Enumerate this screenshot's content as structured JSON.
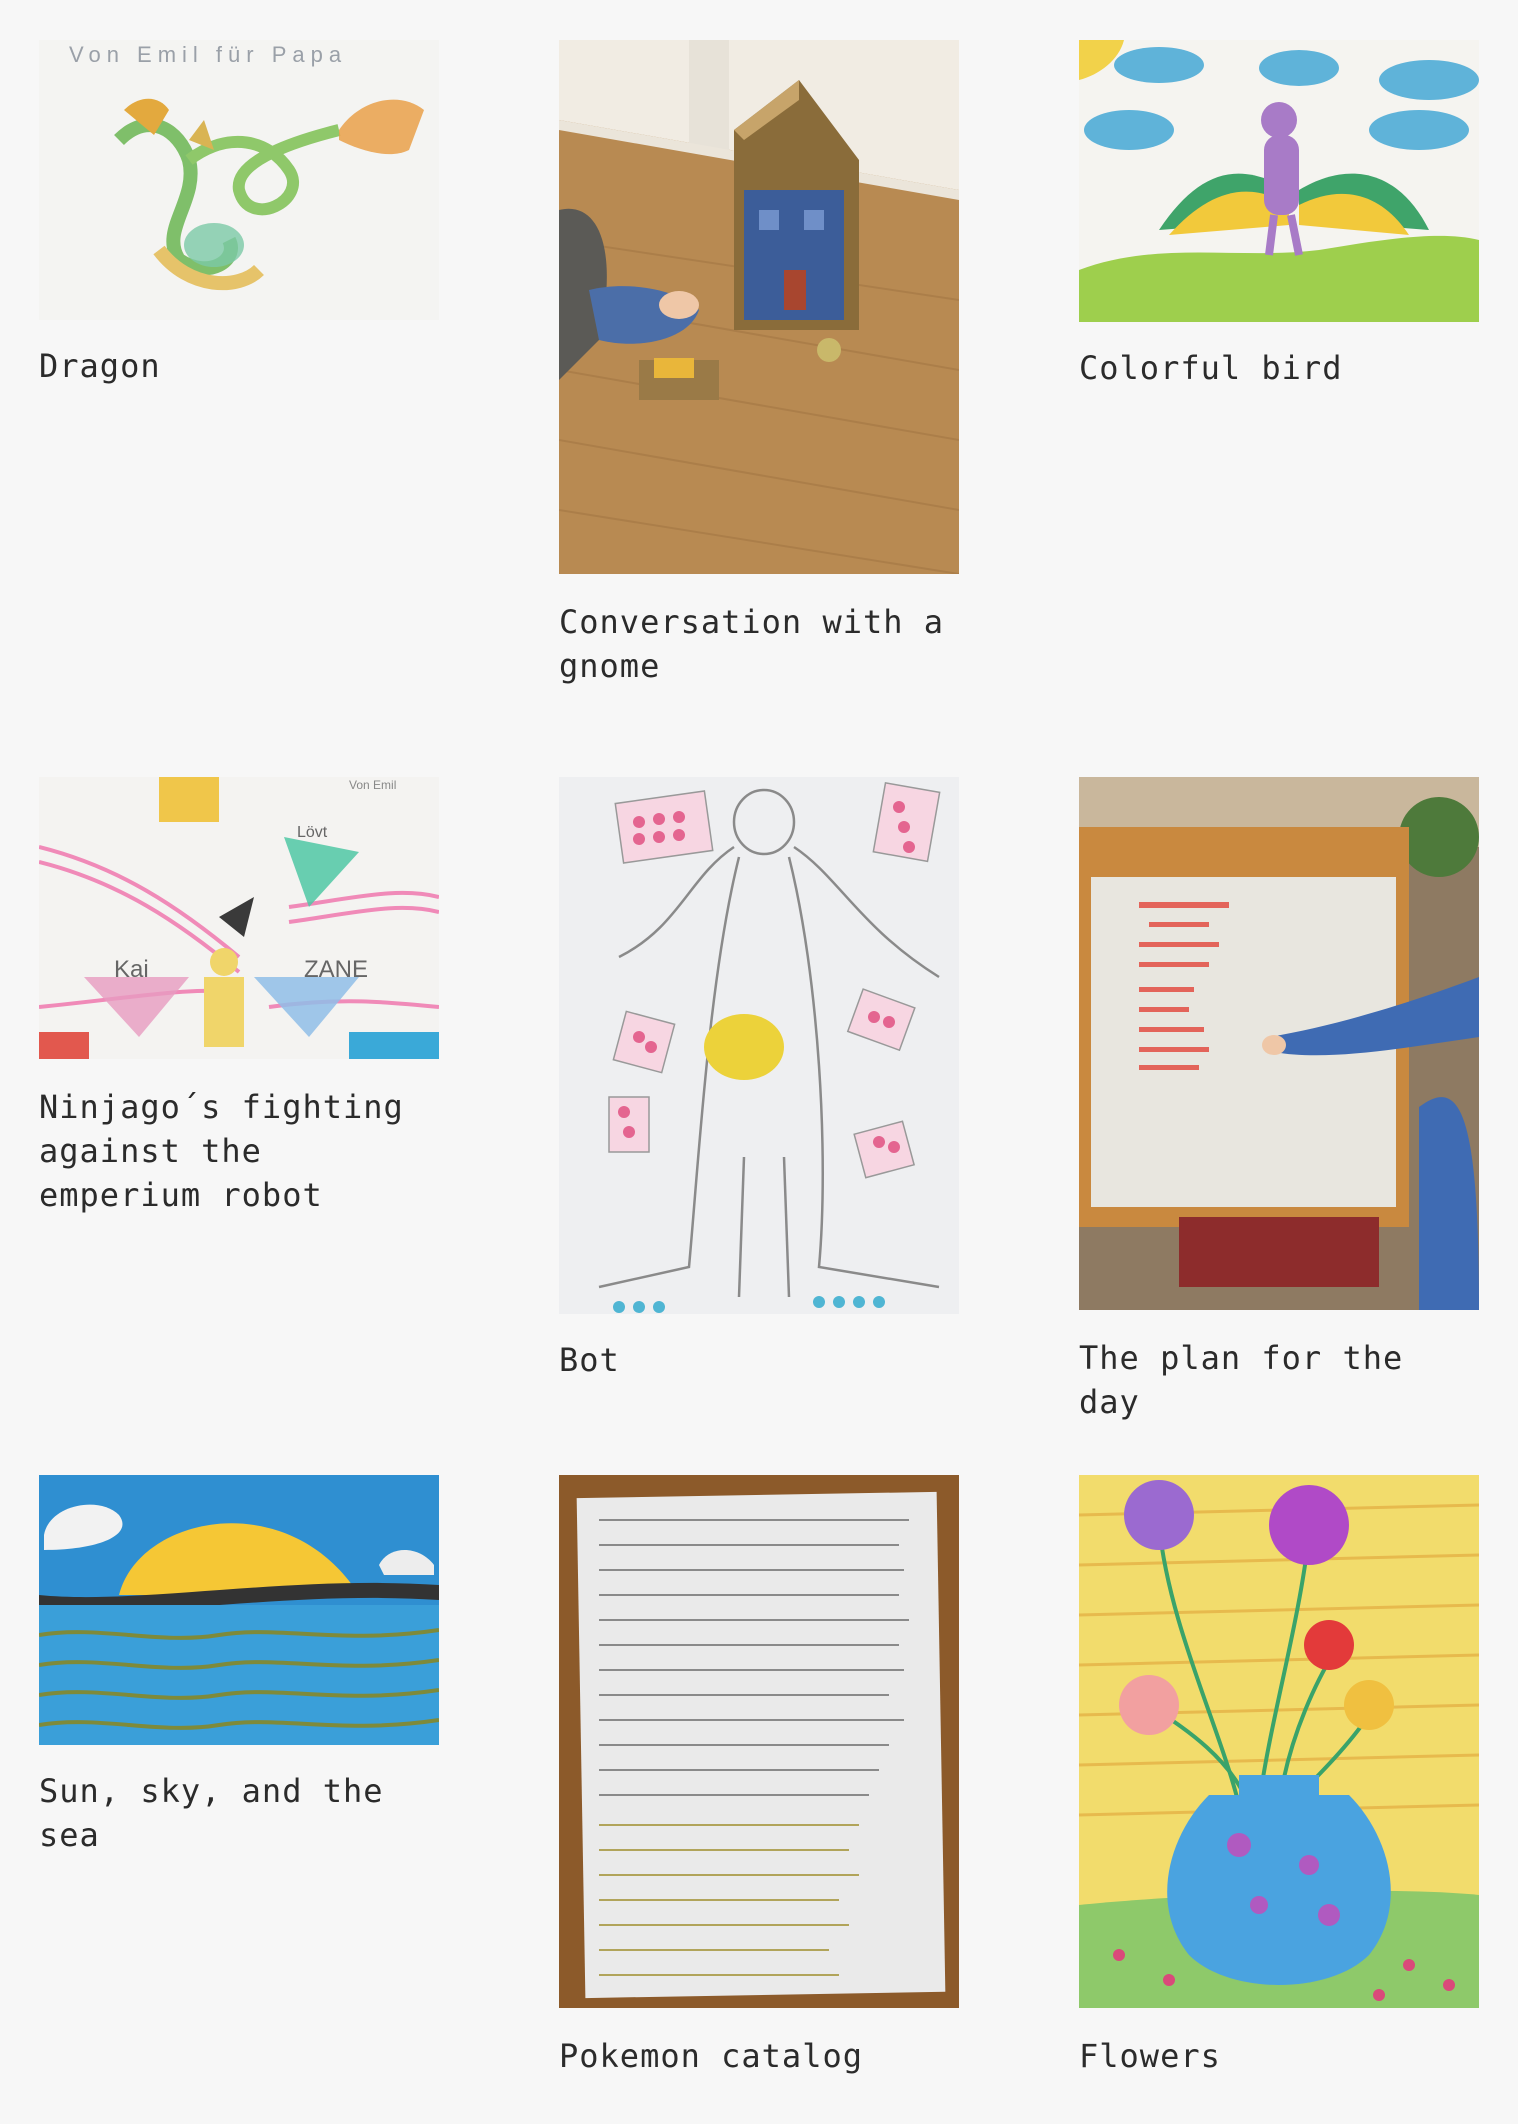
{
  "gallery": {
    "items": [
      {
        "caption": "Dragon",
        "image_alt": "Child's drawing of a green and orange dragon",
        "note": "Von Emil für Papa"
      },
      {
        "caption": "Conversation with a gnome",
        "image_alt": "Photo of a child playing with a cardboard house on a wooden floor"
      },
      {
        "caption": "Colorful bird",
        "image_alt": "Painting of a purple bird with rainbow wings under blue clouds"
      },
      {
        "caption": "Ninjago´s fighting against the emperium robot",
        "image_alt": "Drawing of Ninjago characters fighting a robot",
        "labels": [
          "Kai",
          "ZANE",
          "Lövt",
          "Von Emil"
        ]
      },
      {
        "caption": "Bot",
        "image_alt": "Pencil drawing of a robot with a yellow belly"
      },
      {
        "caption": "The plan for the day",
        "image_alt": "Photo of a child writing a daily plan on a whiteboard easel"
      },
      {
        "caption": "Sun, sky, and the sea",
        "image_alt": "Painting of a yellow sun over a blue sea"
      },
      {
        "caption": "Pokemon catalog",
        "image_alt": "Handwritten list of Pokemon on paper"
      },
      {
        "caption": "Flowers",
        "image_alt": "Painting of flowers in a blue vase"
      }
    ]
  }
}
